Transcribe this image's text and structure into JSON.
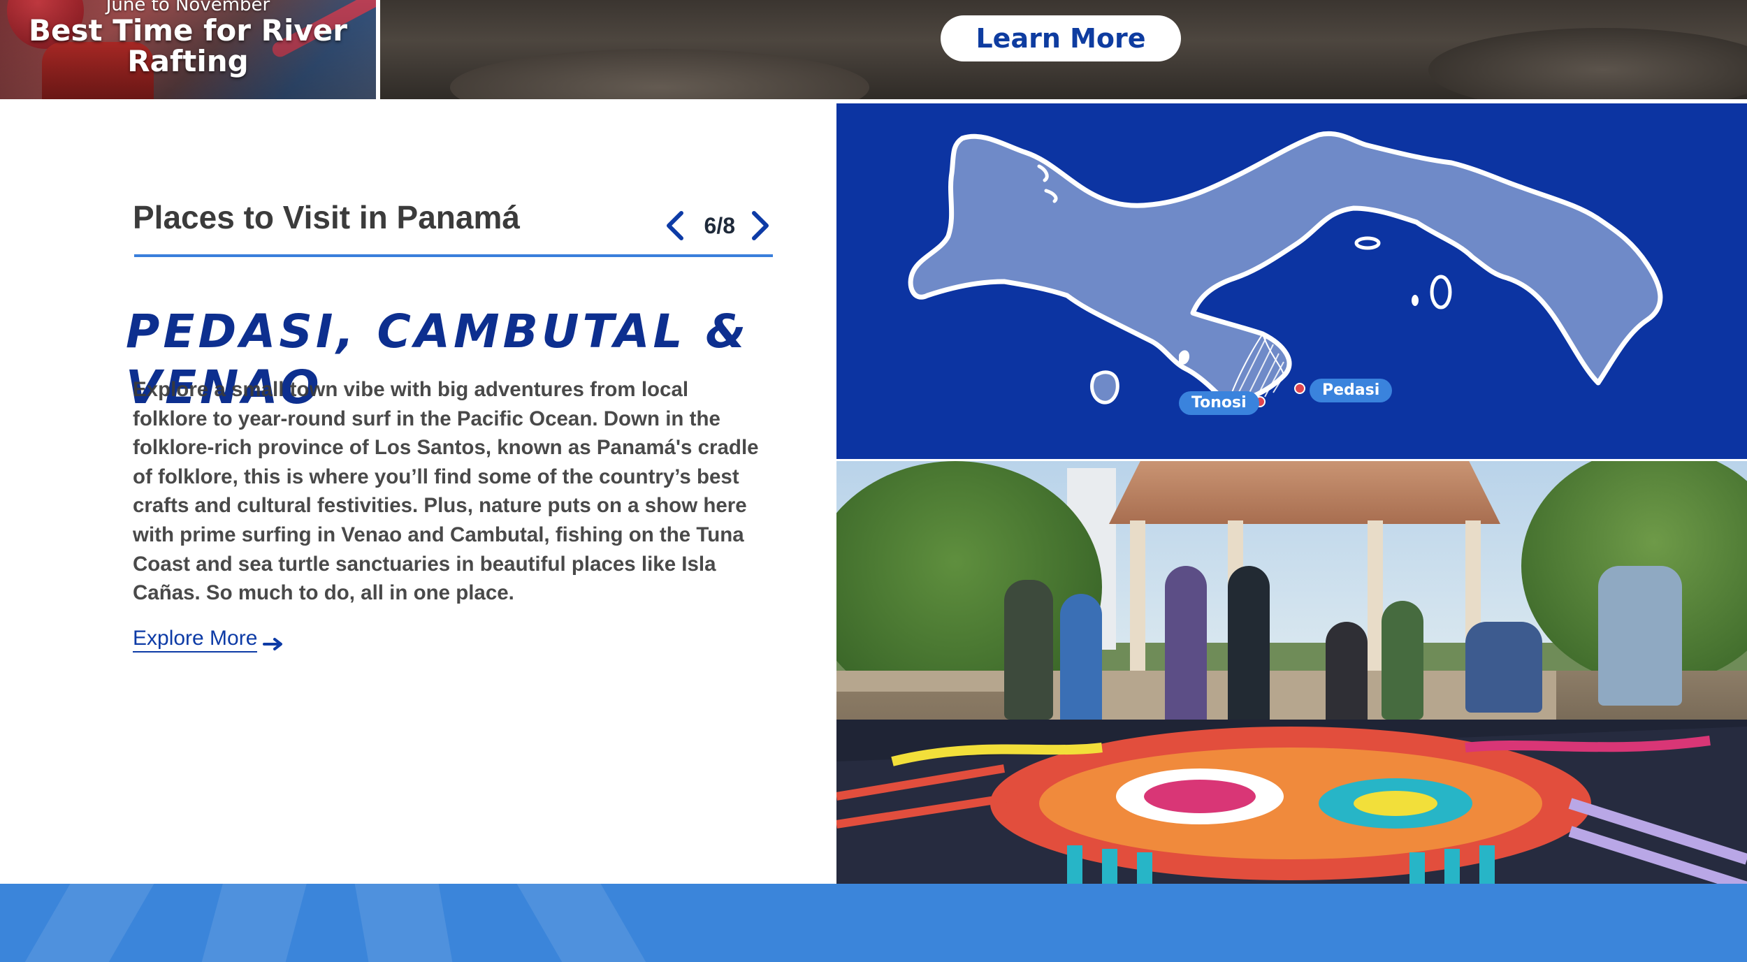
{
  "promo": {
    "subtitle": "June to November",
    "title": "Best Time for River Rafting"
  },
  "hero": {
    "button_label": "Learn More"
  },
  "section": {
    "title": "Places to Visit in Panamá",
    "page_indicator": "6/8",
    "prev_icon": "chevron-left-icon",
    "next_icon": "chevron-right-icon"
  },
  "place": {
    "title": "PEDASI, CAMBUTAL & VENAO",
    "description": "Explore a small town vibe with big adventures from local folklore to year-round surf in the Pacific Ocean. Down in the folklore-rich province of Los Santos,  known as Panamá's cradle of folklore, this is where you’ll find some of the country’s best crafts and cultural festivities. Plus, nature puts on a show here with prime surfing in Venao and Cambutal, fishing on the Tuna Coast and sea turtle sanctuaries in beautiful places like Isla Cañas. So much to do, all in one place.",
    "link_label": "Explore More",
    "link_icon": "arrow-right-icon"
  },
  "map": {
    "labels": {
      "tonosi": "Tonosi",
      "pedasi": "Pedasi"
    }
  },
  "colors": {
    "brand_blue": "#0d2f8f",
    "map_background": "#0c34a2",
    "accent_blue": "#3a7fdb",
    "land": "#6f8ac8",
    "pin": "#e0454f"
  }
}
